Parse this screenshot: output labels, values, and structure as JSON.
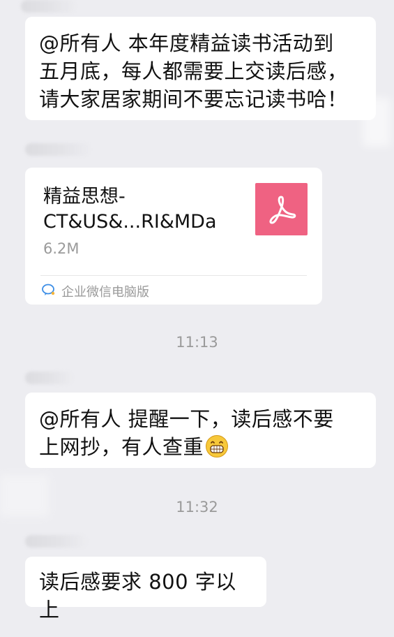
{
  "messages": {
    "m1_text": "@所有人 本年度精益读书活动到\n五月底，每人都需要上交读后感，\n请大家居家期间不要忘记读书哈！",
    "file": {
      "name": "精益思想-\nCT&US&...RI&MDa",
      "size": "6.2M",
      "source": "企业微信电脑版",
      "icon": "pdf-icon"
    },
    "time1": "11:13",
    "m2_text": "@所有人 提醒一下，读后感不要\n上网抄，有人查重",
    "m2_emoji": "grinning-face-icon",
    "time2": "11:32",
    "m3_text": "读后感要求 800 字以上"
  },
  "colors": {
    "background": "#ededf1",
    "bubble": "#ffffff",
    "pdf_accent": "#ef6282",
    "timestamp": "#9a9a9a"
  }
}
